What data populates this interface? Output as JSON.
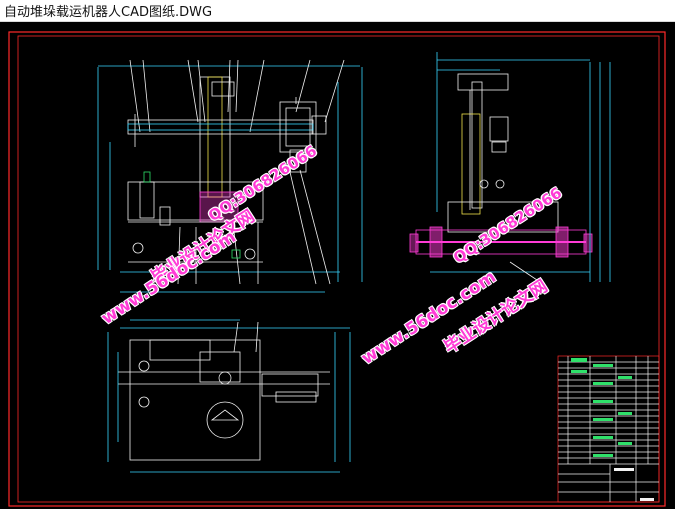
{
  "window": {
    "title": "自动堆垛载运机器人CAD图纸.DWG"
  },
  "watermarks": {
    "site": "www.56doc.com",
    "qq": "QQ:306826066",
    "brand": "毕业设计论文网"
  },
  "colors": {
    "canvas_background": "#000000",
    "border_red": "#ff2a2a",
    "line_white": "#f2f2f2",
    "line_cyan": "#39d6ff",
    "line_green": "#2fe06a",
    "line_yellow": "#f0e34a",
    "line_magenta": "#ff3bd6",
    "watermark_pink": "#ff3bd6"
  }
}
